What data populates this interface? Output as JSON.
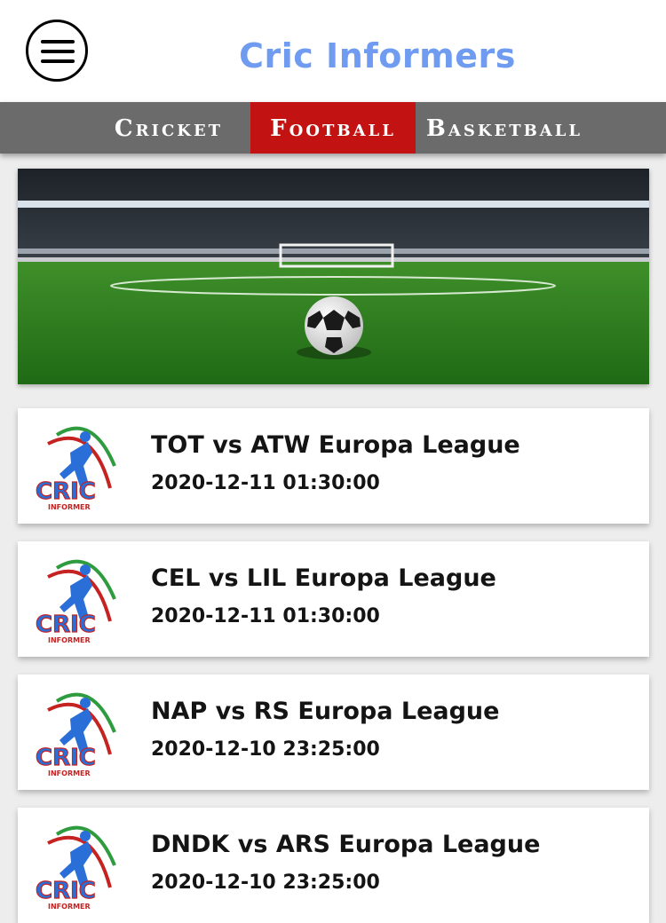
{
  "header": {
    "title": "Cric Informers"
  },
  "tabs": [
    {
      "label": "Cricket",
      "active": false
    },
    {
      "label": "Football",
      "active": true
    },
    {
      "label": "Basketball",
      "active": false
    }
  ],
  "colors": {
    "accent": "#6f9cf0",
    "tab_active": "#c21212",
    "tab_bar": "#6b6b6b"
  },
  "logo": {
    "text": "CRIC",
    "subtext": "INFORMER"
  },
  "matches": [
    {
      "title": "TOT vs ATW Europa League",
      "time": "2020-12-11 01:30:00"
    },
    {
      "title": "CEL vs LIL Europa League",
      "time": "2020-12-11 01:30:00"
    },
    {
      "title": "NAP vs RS Europa League",
      "time": "2020-12-10 23:25:00"
    },
    {
      "title": "DNDK vs ARS Europa League",
      "time": "2020-12-10 23:25:00"
    }
  ]
}
